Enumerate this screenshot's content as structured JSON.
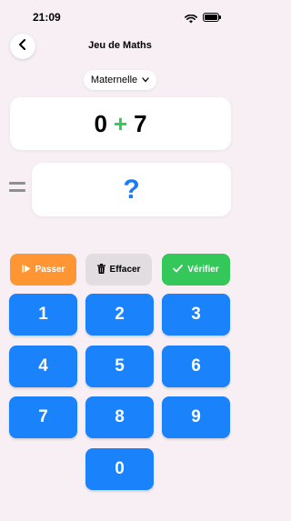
{
  "status": {
    "time": "21:09"
  },
  "header": {
    "title": "Jeu de Maths"
  },
  "level": {
    "label": "Maternelle"
  },
  "problem": {
    "left": "0",
    "operator": "+",
    "right": "7"
  },
  "answer": {
    "value": "?"
  },
  "actions": {
    "skip": "Passer",
    "clear": "Effacer",
    "check": "Vérifier"
  },
  "keypad": {
    "k1": "1",
    "k2": "2",
    "k3": "3",
    "k4": "4",
    "k5": "5",
    "k6": "6",
    "k7": "7",
    "k8": "8",
    "k9": "9",
    "k0": "0"
  },
  "colors": {
    "background": "#f7eff3",
    "accent_blue": "#1a82fb",
    "skip_orange": "#ff9533",
    "check_green": "#34c759",
    "clear_gray": "#e1dde1",
    "operator_green": "#34c759",
    "answer_blue": "#1a7cf5"
  },
  "icons": {
    "back": "chevron-left-icon",
    "level": "chevron-down-icon",
    "skip": "skip-forward-icon",
    "clear": "trash-icon",
    "check": "checkmark-icon",
    "equals": "equals-icon"
  }
}
